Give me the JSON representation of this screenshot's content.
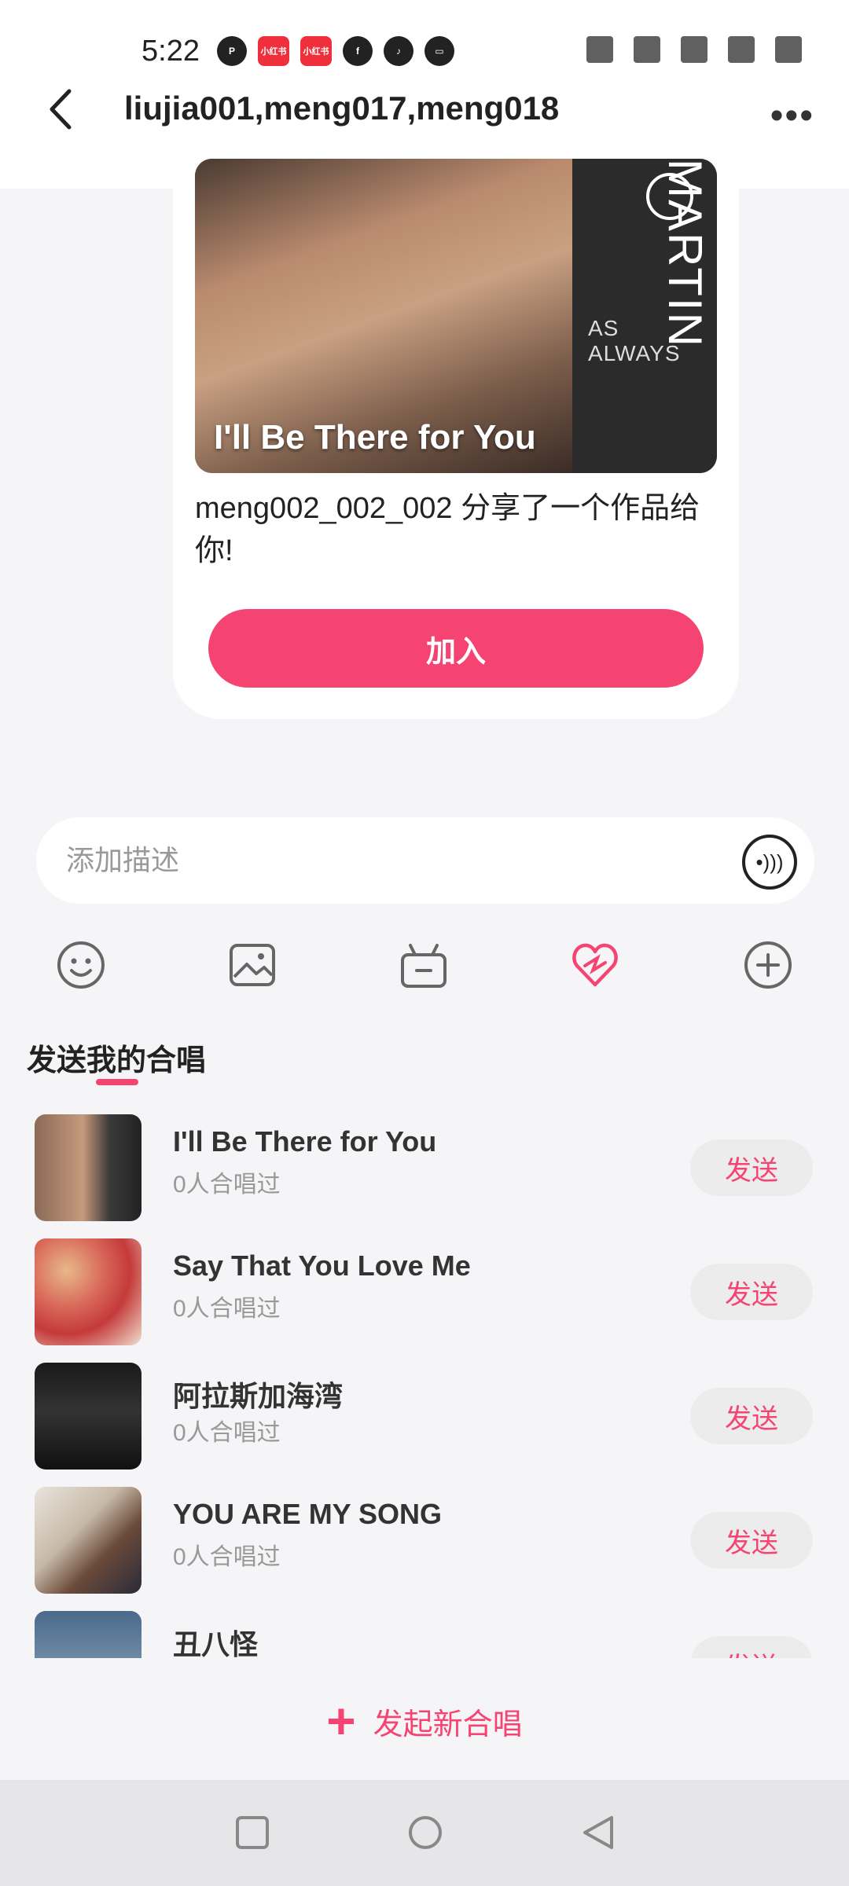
{
  "status_bar": {
    "time": "5:22"
  },
  "header": {
    "title": "liujia001,meng017,meng018"
  },
  "share_card": {
    "cover_title": "I'll Be There for You",
    "cover_subtitle": "AS ALWAYS",
    "cover_vertical_text": "MARTIN NIEVERA",
    "message": "meng002_002_002 分享了一个作品给你!",
    "join_label": "加入"
  },
  "composer": {
    "placeholder": "添加描述"
  },
  "section": {
    "title": "发送我的合唱"
  },
  "songs": [
    {
      "title": "I'll Be There for You",
      "count": "0人合唱过",
      "send": "发送"
    },
    {
      "title": "Say That You Love Me",
      "count": "0人合唱过",
      "send": "发送"
    },
    {
      "title": "阿拉斯加海湾",
      "count": "0人合唱过",
      "send": "发送"
    },
    {
      "title": "YOU ARE MY SONG",
      "count": "0人合唱过",
      "send": "发送"
    },
    {
      "title": "丑八怪",
      "count": "",
      "send": "发送"
    }
  ],
  "new_chorus": {
    "label": "发起新合唱"
  },
  "colors": {
    "accent": "#f64472",
    "background": "#f5f5f7"
  }
}
